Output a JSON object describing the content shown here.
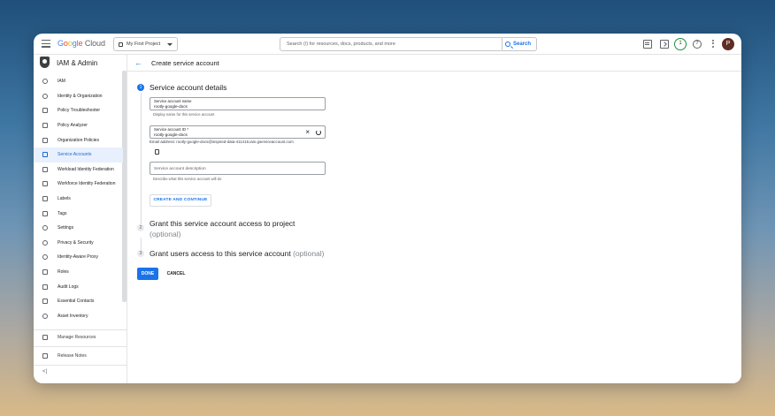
{
  "topbar": {
    "logo_google": [
      "G",
      "o",
      "o",
      "g",
      "l",
      "e"
    ],
    "logo_cloud": "Cloud",
    "project": "My First Project",
    "search_placeholder": "Search (/) for resources, docs, products, and more",
    "search_button": "Search",
    "notification_count": "1",
    "avatar_initial": "P"
  },
  "sidebar": {
    "title": "IAM & Admin",
    "items": [
      {
        "label": "IAM"
      },
      {
        "label": "Identity & Organization"
      },
      {
        "label": "Policy Troubleshooter"
      },
      {
        "label": "Policy Analyzer"
      },
      {
        "label": "Organization Policies"
      },
      {
        "label": "Service Accounts"
      },
      {
        "label": "Workload Identity Federation"
      },
      {
        "label": "Workforce Identity Federation"
      },
      {
        "label": "Labels"
      },
      {
        "label": "Tags"
      },
      {
        "label": "Settings"
      },
      {
        "label": "Privacy & Security"
      },
      {
        "label": "Identity-Aware Proxy"
      },
      {
        "label": "Roles"
      },
      {
        "label": "Audit Logs"
      },
      {
        "label": "Essential Contacts"
      },
      {
        "label": "Asset Inventory"
      }
    ],
    "manage_resources": "Manage Resources",
    "release_notes": "Release Notes",
    "collapse": "<|"
  },
  "page": {
    "title": "Create service account",
    "step1": {
      "num": "1",
      "title": "Service account details"
    },
    "name_field": {
      "label": "Service account name",
      "value": "rootly-google-docs",
      "hint": "Display name for this service account"
    },
    "id_field": {
      "label": "Service account ID *",
      "value": "rootly-google-docs"
    },
    "email": "Email address: rootly-google-docs@inspired-data-411416.iam.gserviceaccount.com",
    "desc_field": {
      "placeholder": "Service account description",
      "hint": "Describe what this service account will do"
    },
    "create_button": "CREATE AND CONTINUE",
    "step2": {
      "num": "2",
      "title": "Grant this service account access to project",
      "optional": "(optional)"
    },
    "step3": {
      "num": "3",
      "title": "Grant users access to this service account",
      "optional": "(optional)"
    },
    "done_button": "DONE",
    "cancel_button": "CANCEL"
  }
}
